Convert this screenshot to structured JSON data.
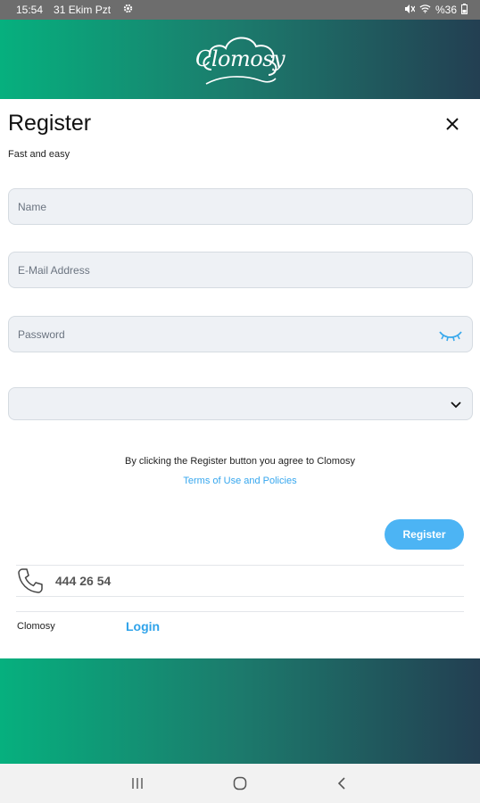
{
  "status": {
    "time": "15:54",
    "date": "31 Ekim Pzt",
    "battery": "%36"
  },
  "brand": {
    "logo_text": "Clomosy",
    "name": "Clomosy"
  },
  "form": {
    "title": "Register",
    "subtitle": "Fast and easy",
    "name_placeholder": "Name",
    "email_placeholder": "E-Mail Address",
    "password_placeholder": "Password",
    "select_value": "",
    "agree_text": "By clicking the Register button you agree to Clomosy",
    "terms_link": "Terms of Use and Policies",
    "register_label": "Register"
  },
  "contact": {
    "phone": "444 26 54"
  },
  "footer": {
    "login_label": "Login"
  },
  "colors": {
    "accent": "#4cb4f4",
    "link": "#2fa3ea",
    "gradient_start": "#06b07e",
    "gradient_end": "#233f52"
  },
  "icons": [
    "settings-gear-icon",
    "mute-icon",
    "wifi-icon",
    "battery-icon",
    "cloud-logo-icon",
    "close-icon",
    "eye-closed-icon",
    "chevron-down-icon",
    "phone-icon",
    "recents-icon",
    "home-icon",
    "back-icon"
  ]
}
